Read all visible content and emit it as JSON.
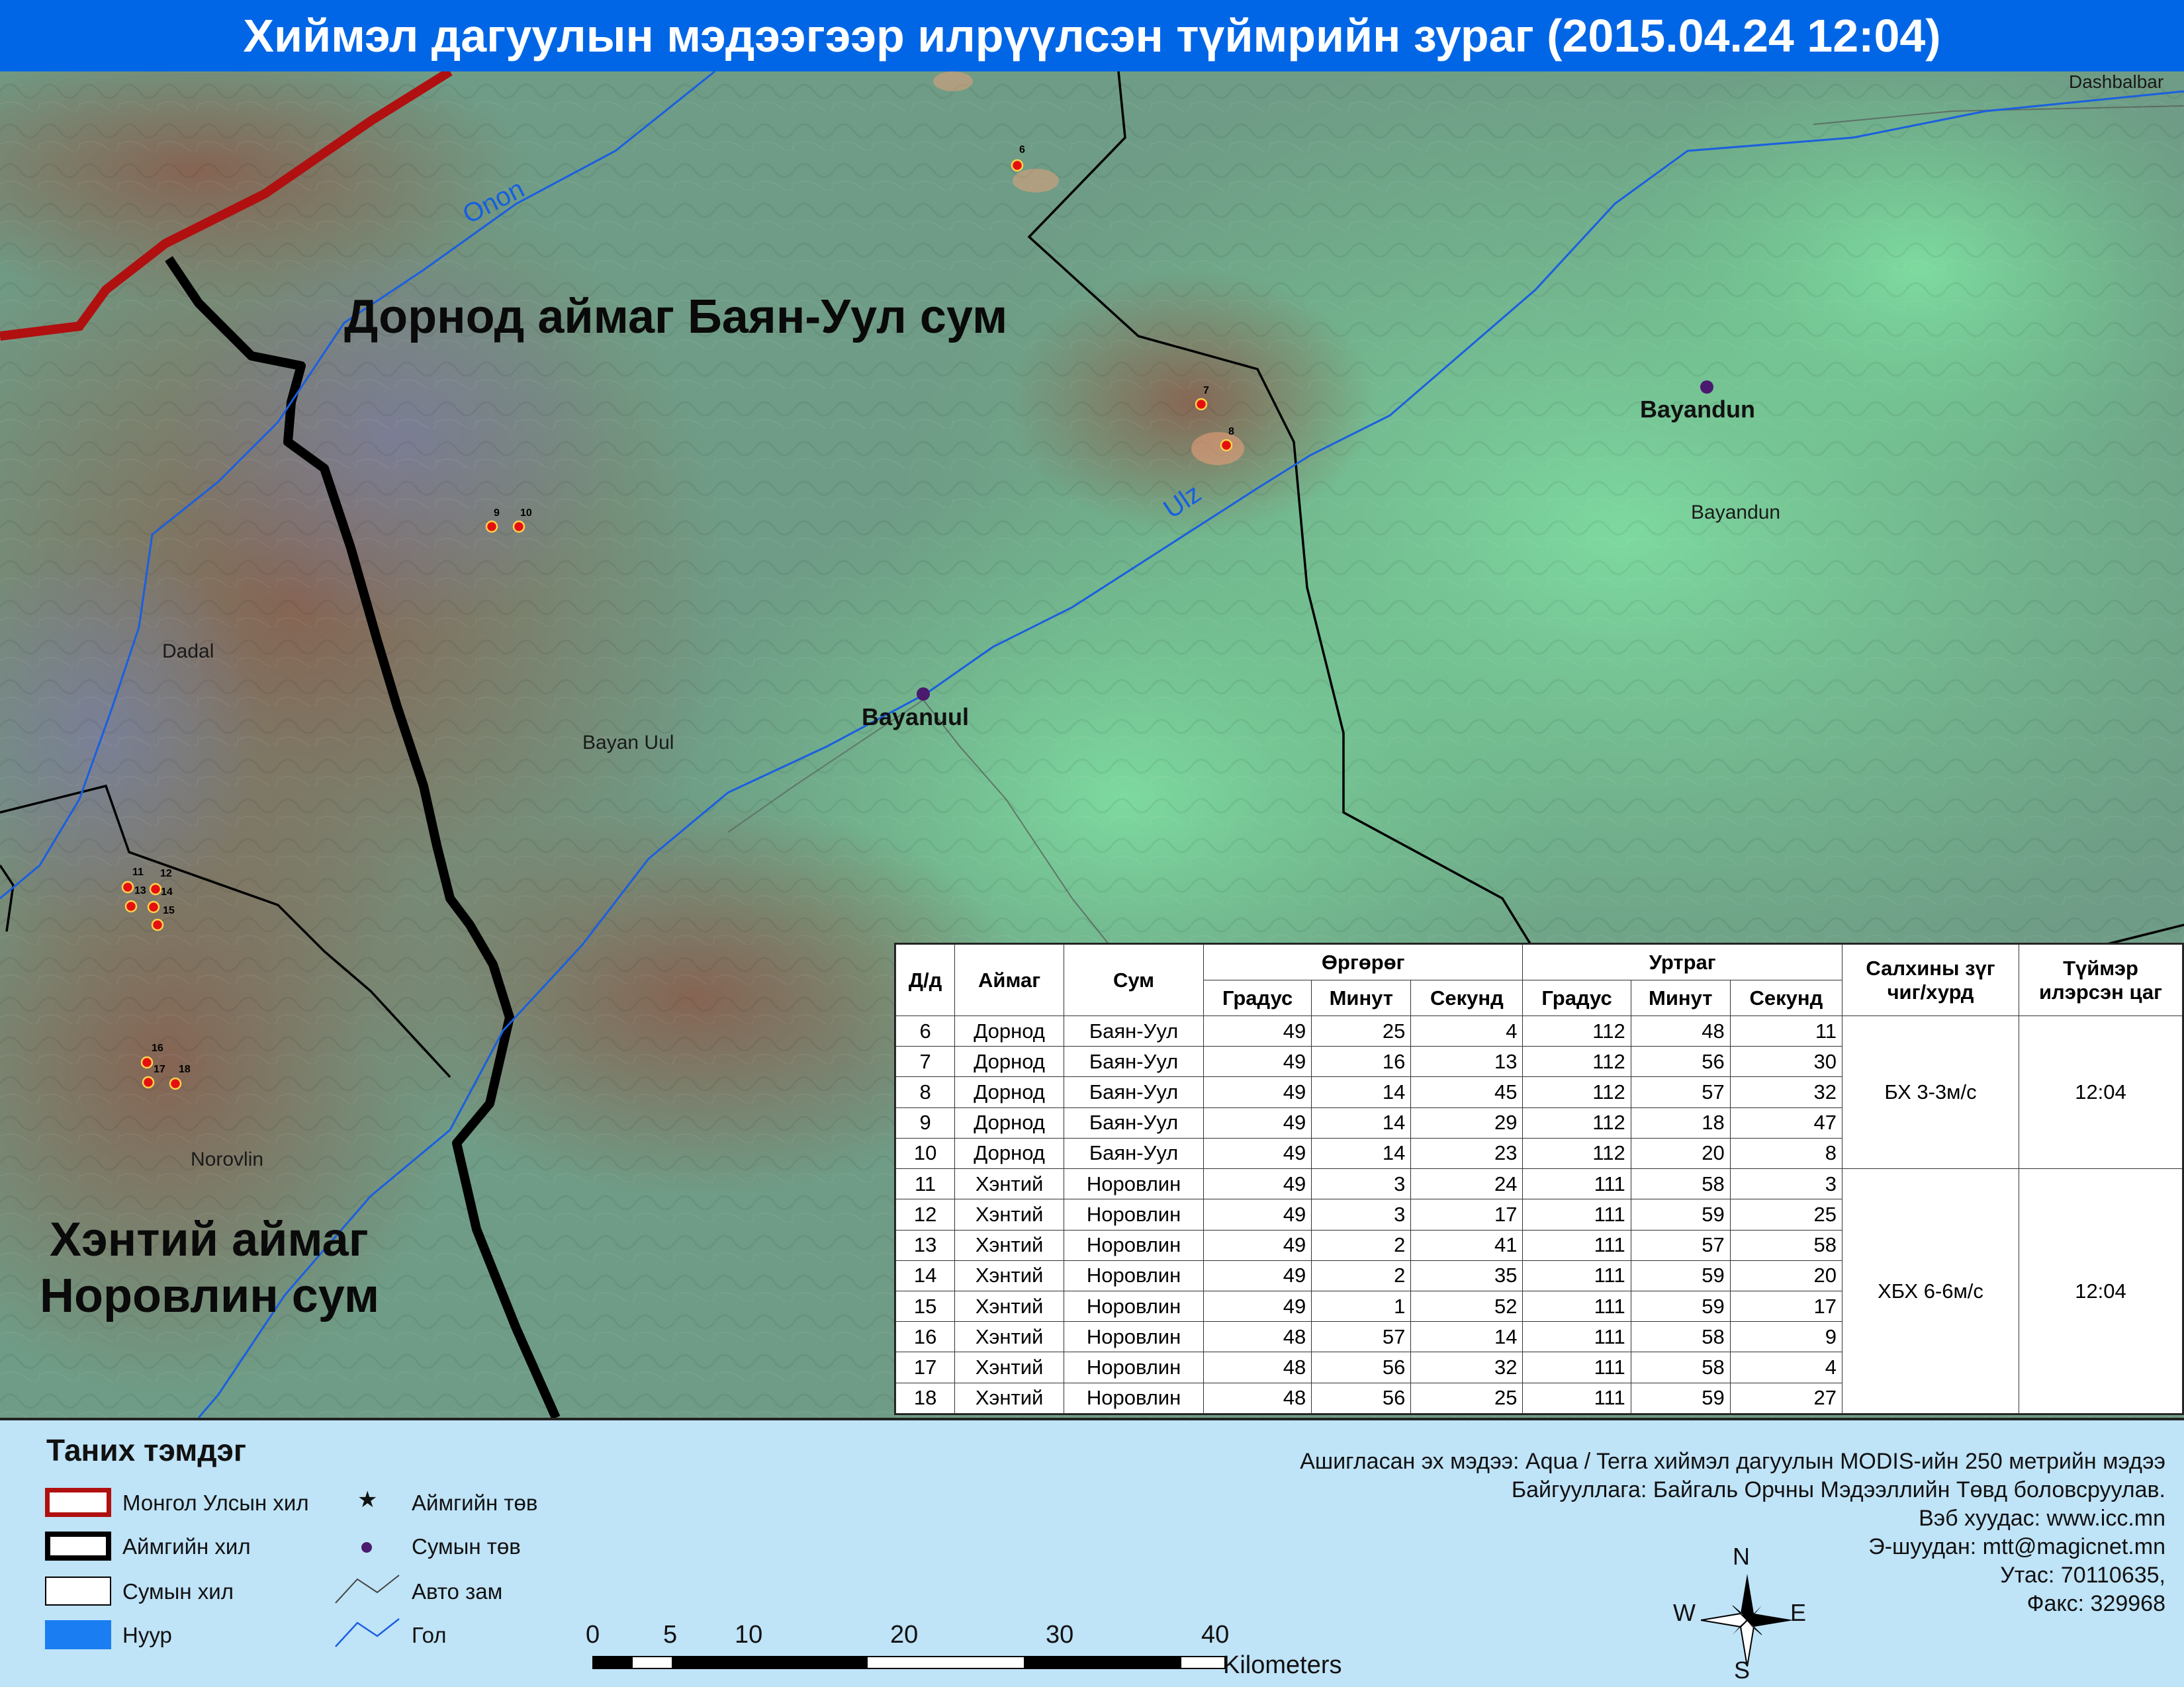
{
  "title": "Хиймэл дагуулын мэдээгээр илрүүлсэн түймрийн зураг  (2015.04.24 12:04)",
  "map": {
    "region_dornod": "Дорнод аймаг Баян-Уул сум",
    "region_khentii_line1": "Хэнтий аймаг",
    "region_khentii_line2": "Норовлин сум",
    "rivers": {
      "onon": "Onon",
      "ulz": "Ulz"
    },
    "places": {
      "bayandun_bold": "Bayandun",
      "bayandun": "Bayandun",
      "bayanuul_bold": "Bayanuul",
      "bayan_uul": "Bayan Uul",
      "dadal": "Dadal",
      "norovlin": "Norovlin",
      "dashbalbar": "Dashbalbar"
    },
    "fire_labels": [
      "6",
      "7",
      "8",
      "9",
      "10",
      "11",
      "12",
      "13",
      "14",
      "15",
      "16",
      "17",
      "18"
    ],
    "colors": {
      "border_mongolia": "#b01010",
      "border_aimag": "#000000",
      "border_sum": "#000000",
      "river": "#1a5fe0",
      "fire": "#e41010",
      "soum_center": "#4a1a6e"
    }
  },
  "table": {
    "headers": {
      "id": "Д/д",
      "aimag": "Аймаг",
      "sum": "Сум",
      "latitude": "Өргөрөг",
      "longitude": "Уртраг",
      "deg": "Градус",
      "min": "Минут",
      "sec": "Секунд",
      "wind": "Салхины зүг чиг/хурд",
      "time": "Түймэр илэрсэн цаг"
    },
    "rows": [
      {
        "id": "6",
        "aimag": "Дорнод",
        "sum": "Баян-Уул",
        "lat_d": "49",
        "lat_m": "25",
        "lat_s": "4",
        "lon_d": "112",
        "lon_m": "48",
        "lon_s": "11"
      },
      {
        "id": "7",
        "aimag": "Дорнод",
        "sum": "Баян-Уул",
        "lat_d": "49",
        "lat_m": "16",
        "lat_s": "13",
        "lon_d": "112",
        "lon_m": "56",
        "lon_s": "30"
      },
      {
        "id": "8",
        "aimag": "Дорнод",
        "sum": "Баян-Уул",
        "lat_d": "49",
        "lat_m": "14",
        "lat_s": "45",
        "lon_d": "112",
        "lon_m": "57",
        "lon_s": "32"
      },
      {
        "id": "9",
        "aimag": "Дорнод",
        "sum": "Баян-Уул",
        "lat_d": "49",
        "lat_m": "14",
        "lat_s": "29",
        "lon_d": "112",
        "lon_m": "18",
        "lon_s": "47"
      },
      {
        "id": "10",
        "aimag": "Дорнод",
        "sum": "Баян-Уул",
        "lat_d": "49",
        "lat_m": "14",
        "lat_s": "23",
        "lon_d": "112",
        "lon_m": "20",
        "lon_s": "8"
      },
      {
        "id": "11",
        "aimag": "Хэнтий",
        "sum": "Норовлин",
        "lat_d": "49",
        "lat_m": "3",
        "lat_s": "24",
        "lon_d": "111",
        "lon_m": "58",
        "lon_s": "3"
      },
      {
        "id": "12",
        "aimag": "Хэнтий",
        "sum": "Норовлин",
        "lat_d": "49",
        "lat_m": "3",
        "lat_s": "17",
        "lon_d": "111",
        "lon_m": "59",
        "lon_s": "25"
      },
      {
        "id": "13",
        "aimag": "Хэнтий",
        "sum": "Норовлин",
        "lat_d": "49",
        "lat_m": "2",
        "lat_s": "41",
        "lon_d": "111",
        "lon_m": "57",
        "lon_s": "58"
      },
      {
        "id": "14",
        "aimag": "Хэнтий",
        "sum": "Норовлин",
        "lat_d": "49",
        "lat_m": "2",
        "lat_s": "35",
        "lon_d": "111",
        "lon_m": "59",
        "lon_s": "20"
      },
      {
        "id": "15",
        "aimag": "Хэнтий",
        "sum": "Норовлин",
        "lat_d": "49",
        "lat_m": "1",
        "lat_s": "52",
        "lon_d": "111",
        "lon_m": "59",
        "lon_s": "17"
      },
      {
        "id": "16",
        "aimag": "Хэнтий",
        "sum": "Норовлин",
        "lat_d": "48",
        "lat_m": "57",
        "lat_s": "14",
        "lon_d": "111",
        "lon_m": "58",
        "lon_s": "9"
      },
      {
        "id": "17",
        "aimag": "Хэнтий",
        "sum": "Норовлин",
        "lat_d": "48",
        "lat_m": "56",
        "lat_s": "32",
        "lon_d": "111",
        "lon_m": "58",
        "lon_s": "4"
      },
      {
        "id": "18",
        "aimag": "Хэнтий",
        "sum": "Норовлин",
        "lat_d": "48",
        "lat_m": "56",
        "lat_s": "25",
        "lon_d": "111",
        "lon_m": "59",
        "lon_s": "27"
      }
    ],
    "groups": [
      {
        "wind": "БХ 3-3м/с",
        "time": "12:04"
      },
      {
        "wind": "ХБХ 6-6м/с",
        "time": "12:04"
      }
    ]
  },
  "legend": {
    "title": "Таних тэмдэг",
    "items": {
      "mongolia_border": "Монгол Улсын хил",
      "aimag_border": "Аймгийн хил",
      "sum_border": "Сумын хил",
      "lake": "Нуур",
      "aimag_center": "Аймгийн төв",
      "sum_center": "Сумын төв",
      "road": "Авто зам",
      "river": "Гол"
    }
  },
  "scale": {
    "ticks": [
      "0",
      "5",
      "10",
      "20",
      "30",
      "40"
    ],
    "unit": "Kilometers"
  },
  "compass": {
    "n": "N",
    "s": "S",
    "e": "E",
    "w": "W"
  },
  "info": {
    "line1": "Ашигласан эх мэдээ: Aqua / Terra хиймэл дагуулын MODIS-ийн 250 метрийн мэдээ",
    "line2": "Байгууллага: Байгаль Орчны Мэдээллийн Төвд боловсруулав.",
    "line3": "Вэб хуудас: www.icc.mn",
    "line4": "Э-шуудан: mtt@magicnet.mn",
    "line5": "Утас: 70110635,",
    "line6": "Факс: 329968"
  }
}
